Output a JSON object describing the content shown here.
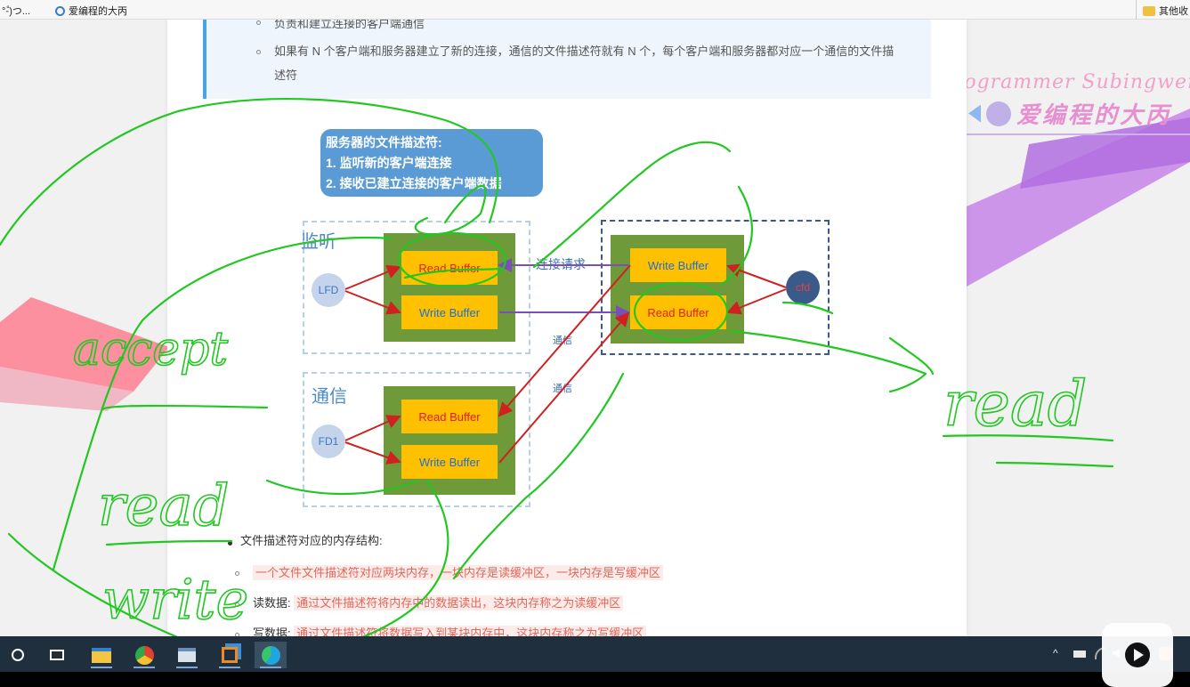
{
  "bookmarks": {
    "item1": "°-゚)つ...",
    "item2": "爱编程的大丙",
    "other": "其他收"
  },
  "article": {
    "quote_line1": "负责和建立连接的客户端通信",
    "quote_line2a": "如果有 N 个客户端和服务器建立了新的连接，通信的文件描述符就有 N 个，每个客户端和服务器都对应一个通信的文件描",
    "quote_line2b": "述符",
    "section_title": "文件描述符对应的内存结构:",
    "items": [
      {
        "prefix": "",
        "text": "一个文件文件描述符对应两块内存，一块内存是读缓冲区，一块内存是写缓冲区"
      },
      {
        "prefix": "读数据: ",
        "text": "通过文件描述符将内存中的数据读出，这块内存称之为读缓冲区"
      },
      {
        "prefix": "写数据: ",
        "text": "通过文件描述符将数据写入到某块内存中，这块内存称之为写缓冲区"
      }
    ]
  },
  "diagram": {
    "server_box_line1": "服务器的文件描述符:",
    "server_box_line2": "1. 监听新的客户端连接",
    "server_box_line3": "2. 接收已建立连接的客户端数据",
    "listen_label": "监听",
    "comm_label": "通信",
    "lfd": "LFD",
    "fd1": "FD1",
    "cfd": "cfd",
    "read_buffer": "Read Buffer",
    "write_buffer": "Write Buffer",
    "conn_request": "连接请求",
    "comm_small1": "通信",
    "comm_small2": "通信"
  },
  "watermark": {
    "line1": "Programmer Subingwen.cn",
    "line2": "爱编程的大丙"
  },
  "annotations": {
    "accept": "accept",
    "read_left": "read",
    "write": "write",
    "read_right": "read"
  },
  "tray": {
    "ime": "中"
  },
  "colors": {
    "ink": "#22c722",
    "buffer_yellow": "#ffc000",
    "buffer_green": "#6f9a3a",
    "server_box": "#5b9bd5",
    "taskbar": "#1f2f3e"
  }
}
